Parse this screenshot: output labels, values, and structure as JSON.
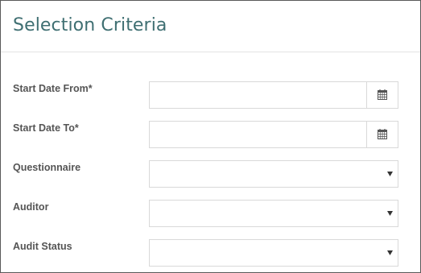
{
  "panel": {
    "title": "Selection Criteria"
  },
  "fields": {
    "start_date_from": {
      "label": "Start Date From*",
      "value": "",
      "placeholder": "",
      "icon": "calendar-icon"
    },
    "start_date_to": {
      "label": "Start Date To*",
      "value": "",
      "placeholder": "",
      "icon": "calendar-icon"
    },
    "questionnaire": {
      "label": "Questionnaire",
      "selected": "",
      "icon": "caret-down-icon"
    },
    "auditor": {
      "label": "Auditor",
      "selected": "",
      "icon": "caret-down-icon"
    },
    "audit_status": {
      "label": "Audit Status",
      "selected": "",
      "icon": "caret-down-icon"
    }
  },
  "colors": {
    "title": "#3f6f72",
    "label": "#555555",
    "border": "#d9d9d9",
    "frame": "#5a5a5a"
  }
}
